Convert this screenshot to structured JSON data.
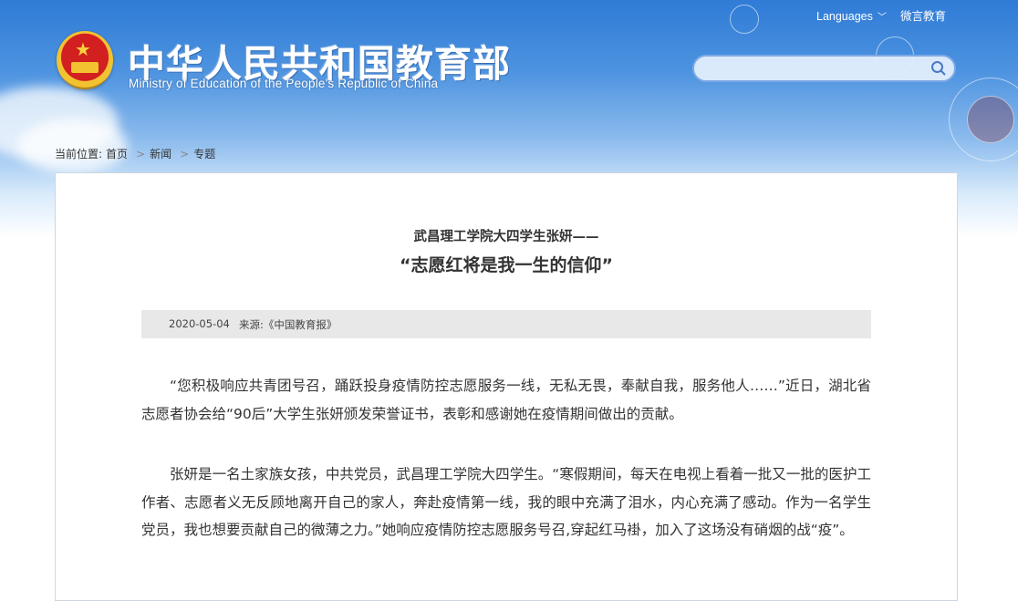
{
  "header": {
    "title_cn": "中华人民共和国教育部",
    "title_en": "Ministry of Education of the People's Republic of China",
    "languages_label": "Languages",
    "weiyan_label": "微言教育",
    "search_placeholder": ""
  },
  "breadcrumb": {
    "prefix": "当前位置:",
    "items": [
      "首页",
      "新闻",
      "专题"
    ]
  },
  "article": {
    "subtitle": "武昌理工学院大四学生张妍——",
    "title": "“志愿红将是我一生的信仰”",
    "date": "2020-05-04",
    "source": "来源:《中国教育报》",
    "paragraphs": [
      "“您积极响应共青团号召，踊跃投身疫情防控志愿服务一线，无私无畏，奉献自我，服务他人……”近日，湖北省志愿者协会给“90后”大学生张妍颁发荣誉证书，表彰和感谢她在疫情期间做出的贡献。",
      "张妍是一名土家族女孩，中共党员，武昌理工学院大四学生。“寒假期间，每天在电视上看着一批又一批的医护工作者、志愿者义无反顾地离开自己的家人，奔赴疫情第一线，我的眼中充满了泪水，内心充满了感动。作为一名学生党员，我也想要贡献自己的微薄之力。”她响应疫情防控志愿服务号召,穿起红马褂，加入了这场没有硝烟的战“疫”。"
    ]
  },
  "colors": {
    "banner_blue": "#2f7bd6",
    "text": "#333333",
    "meta_bg": "#e8e8e8"
  }
}
